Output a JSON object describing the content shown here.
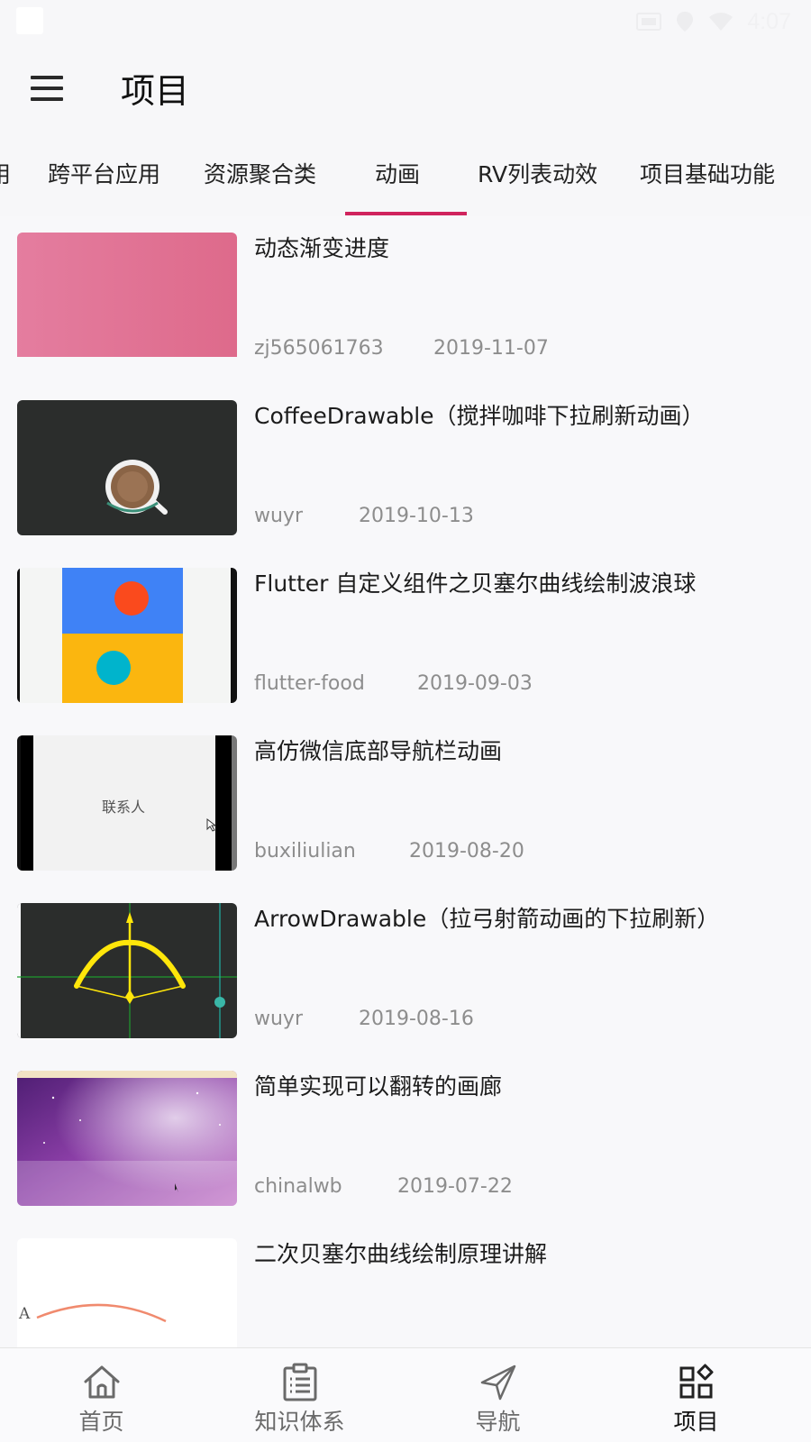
{
  "status_bar": {
    "time": "4:07"
  },
  "app_bar": {
    "title": "项目"
  },
  "tabs": [
    {
      "label": "用"
    },
    {
      "label": "跨平台应用"
    },
    {
      "label": "资源聚合类"
    },
    {
      "label": "动画",
      "selected": true
    },
    {
      "label": "RV列表动效"
    },
    {
      "label": "项目基础功能"
    }
  ],
  "items": [
    {
      "title": "动态渐变进度",
      "author": "zj565061763",
      "date": "2019-11-07"
    },
    {
      "title": "CoffeeDrawable（搅拌咖啡下拉刷新动画）",
      "author": "wuyr",
      "date": "2019-10-13"
    },
    {
      "title": "Flutter 自定义组件之贝塞尔曲线绘制波浪球",
      "author": "flutter-food",
      "date": "2019-09-03"
    },
    {
      "title": "高仿微信底部导航栏动画",
      "author": "buxiliulian",
      "date": "2019-08-20",
      "thumb_text": "联系人"
    },
    {
      "title": "ArrowDrawable（拉弓射箭动画的下拉刷新）",
      "author": "wuyr",
      "date": "2019-08-16"
    },
    {
      "title": "简单实现可以翻转的画廊",
      "author": "chinalwb",
      "date": "2019-07-22"
    },
    {
      "title": "二次贝塞尔曲线绘制原理讲解",
      "author": "",
      "date": "",
      "thumb_text": "A"
    }
  ],
  "bottom_nav": [
    {
      "label": "首页",
      "icon": "home-icon"
    },
    {
      "label": "知识体系",
      "icon": "clipboard-icon"
    },
    {
      "label": "导航",
      "icon": "navigation-icon"
    },
    {
      "label": "项目",
      "icon": "grid-icon",
      "selected": true
    }
  ],
  "colors": {
    "accent": "#d0245d",
    "background": "#f8f8fa",
    "divider": "#dedede"
  }
}
